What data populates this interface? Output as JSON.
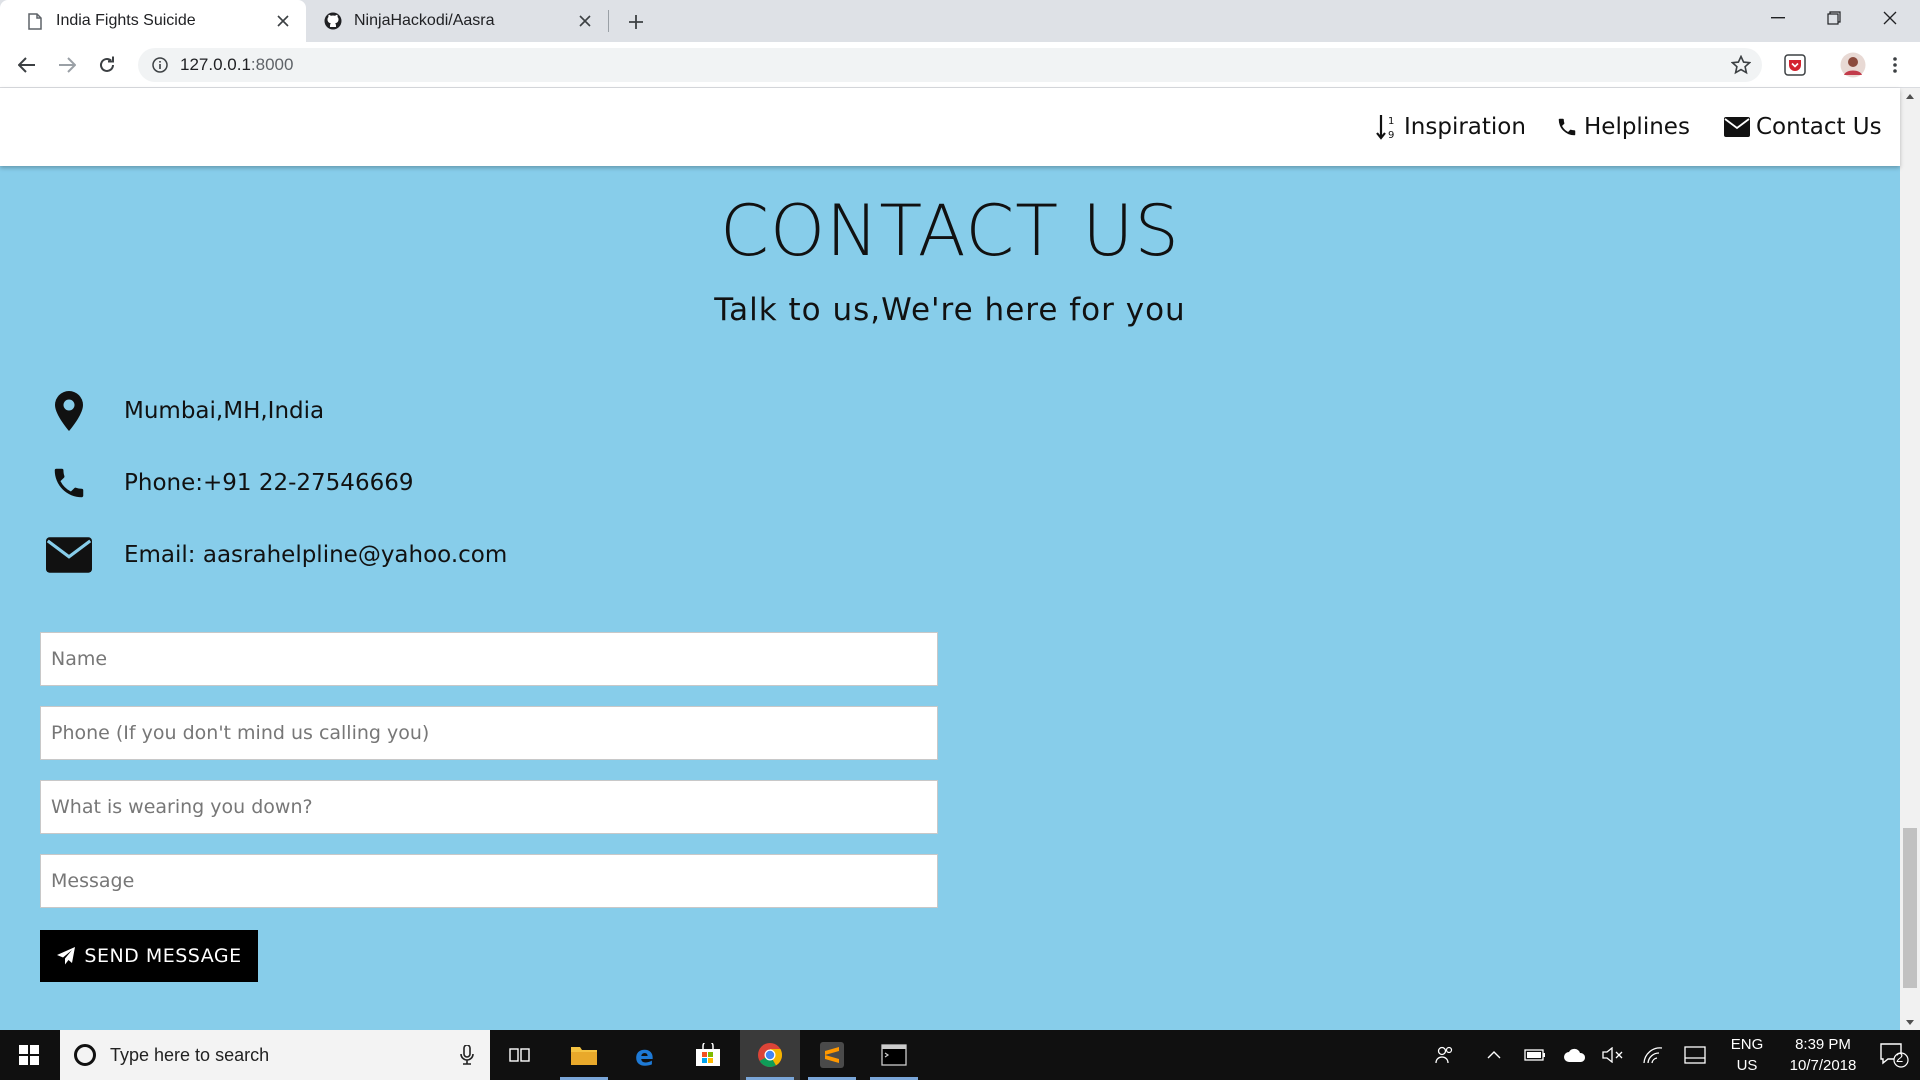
{
  "browser": {
    "tabs": [
      {
        "title": "India Fights Suicide",
        "active": true
      },
      {
        "title": "NinjaHackodi/Aasra",
        "active": false
      }
    ],
    "url_host": "127.0.0.1",
    "url_port": ":8000"
  },
  "site_nav": {
    "items": [
      {
        "label": "Inspiration",
        "icon": "sort-numeric-icon"
      },
      {
        "label": "Helplines",
        "icon": "phone-icon"
      },
      {
        "label": "Contact Us",
        "icon": "envelope-icon"
      }
    ]
  },
  "contact": {
    "heading": "CONTACT US",
    "subheading": "Talk to us,We're here for you",
    "address": "Mumbai,MH,India",
    "phone": "Phone:+91 22-27546669",
    "email": "Email: aasrahelpline@yahoo.com"
  },
  "form": {
    "name_placeholder": "Name",
    "phone_placeholder": "Phone (If you don't mind us calling you)",
    "subject_placeholder": "What is wearing you down?",
    "message_placeholder": "Message",
    "send_label": "SEND MESSAGE"
  },
  "taskbar": {
    "search_placeholder": "Type here to search",
    "lang_line1": "ENG",
    "lang_line2": "US",
    "time": "8:39 PM",
    "date": "10/7/2018",
    "notification_count": "2"
  },
  "colors": {
    "page_background": "#87cdea",
    "button_background": "#000000",
    "taskbar": "#101010"
  }
}
